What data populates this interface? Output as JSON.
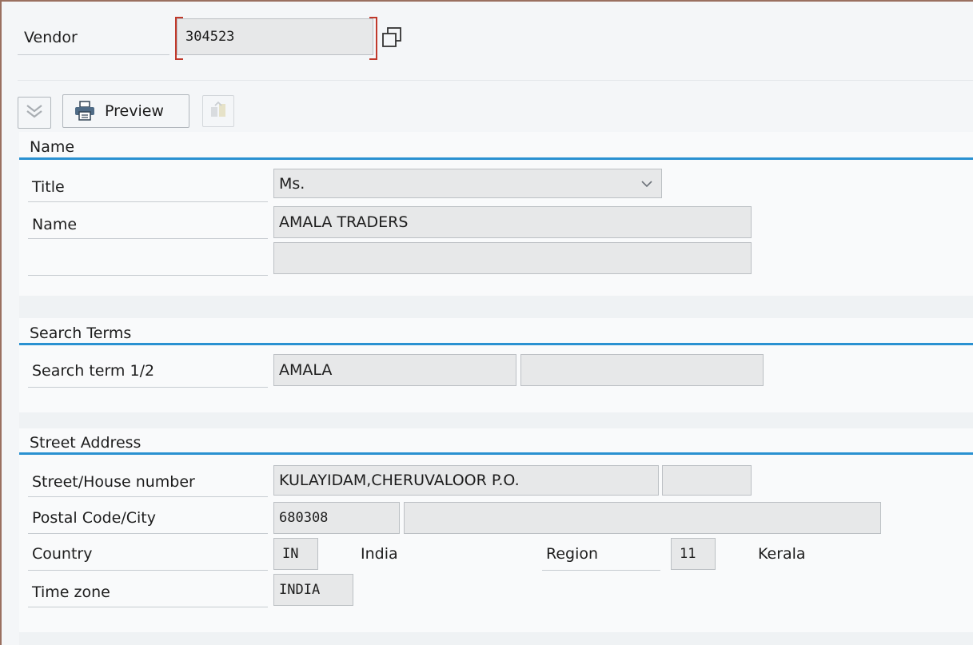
{
  "header": {
    "vendor_label": "Vendor",
    "vendor_value": "304523"
  },
  "toolbar": {
    "preview_label": "Preview"
  },
  "sections": {
    "name": {
      "title": "Name",
      "title_label": "Title",
      "title_value": "Ms.",
      "name_label": "Name",
      "name_value": "AMALA TRADERS",
      "name2_value": ""
    },
    "search": {
      "title": "Search Terms",
      "term_label": "Search term 1/2",
      "term1_value": "AMALA",
      "term2_value": ""
    },
    "address": {
      "title": "Street Address",
      "street_label": "Street/House number",
      "street_value": "KULAYIDAM,CHERUVALOOR P.O.",
      "house_value": "",
      "postal_label": "Postal Code/City",
      "postal_value": "680308",
      "city_value": "",
      "country_label": "Country",
      "country_code": "IN",
      "country_name": "India",
      "region_label": "Region",
      "region_code": "11",
      "region_name": "Kerala",
      "timezone_label": "Time zone",
      "timezone_value": "INDIA"
    }
  },
  "colors": {
    "accent_line": "#2a91d1",
    "field_bg": "#e7e8e9",
    "required_marker": "#c0392b"
  },
  "icons": [
    "collapse-icon",
    "printer-icon",
    "copy-icon",
    "transfer-icon",
    "dropdown-chevron-icon"
  ]
}
